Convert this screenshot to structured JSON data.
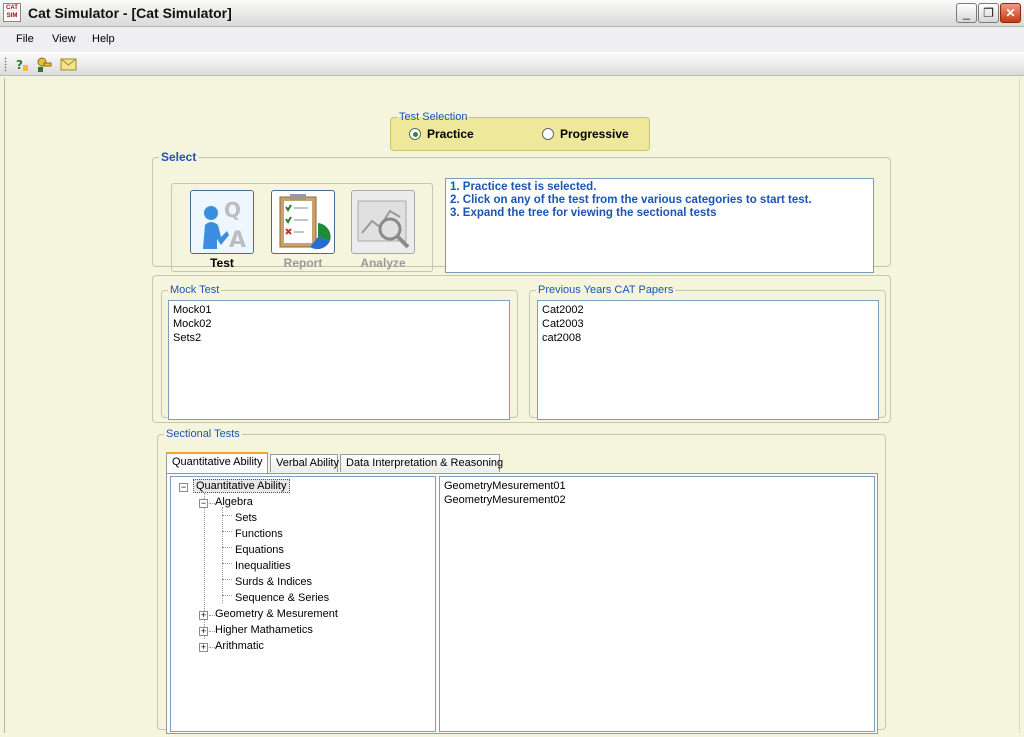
{
  "window": {
    "title": "Cat Simulator - [Cat Simulator]",
    "icon_text": "CAT SIM",
    "controls": [
      "minimize-icon",
      "restore-icon",
      "close-icon"
    ]
  },
  "menu": {
    "file": "File",
    "view": "View",
    "help": "Help"
  },
  "toolbar": {
    "icons": [
      "help-icon",
      "key-icon",
      "envelope-icon"
    ]
  },
  "test_selection": {
    "legend": "Test Selection",
    "options": [
      {
        "label": "Practice",
        "selected": true
      },
      {
        "label": "Progressive",
        "selected": false
      }
    ]
  },
  "select": {
    "legend": "Select",
    "tiles": [
      {
        "label": "Test",
        "enabled": true,
        "icon": "test-figure-icon"
      },
      {
        "label": "Report",
        "enabled": false,
        "icon": "report-clipboard-icon"
      },
      {
        "label": "Analyze",
        "enabled": false,
        "icon": "analyze-chart-icon"
      }
    ],
    "info_lines": [
      "1. Practice test is selected.",
      "2. Click on any of the test from the various categories to start test.",
      "3. Expand the tree for viewing the sectional tests"
    ]
  },
  "mock_test": {
    "legend": "Mock Test",
    "items": [
      "Mock01",
      "Mock02",
      "Sets2"
    ]
  },
  "previous_papers": {
    "legend": "Previous Years CAT Papers",
    "items": [
      "Cat2002",
      "Cat2003",
      "cat2008"
    ]
  },
  "sectional": {
    "legend": "Sectional Tests",
    "tabs": [
      "Quantitative Ability",
      "Verbal Ability",
      "Data Interpretation & Reasoning"
    ],
    "active_tab": 0,
    "tree": {
      "root": "Quantitative Ability",
      "algebra": "Algebra",
      "algebra_children": [
        "Sets",
        "Functions",
        "Equations",
        "Inequalities",
        "Surds & Indices",
        "Sequence & Series"
      ],
      "collapsed": [
        "Geometry & Mesurement",
        "Higher Mathametics",
        "Arithmatic"
      ]
    },
    "results": [
      "GeometryMesurement01",
      "GeometryMesurement02"
    ]
  },
  "colors": {
    "accent_blue": "#1a55b5",
    "background": "#f5f4dc",
    "selection_panel": "#ede89a"
  }
}
